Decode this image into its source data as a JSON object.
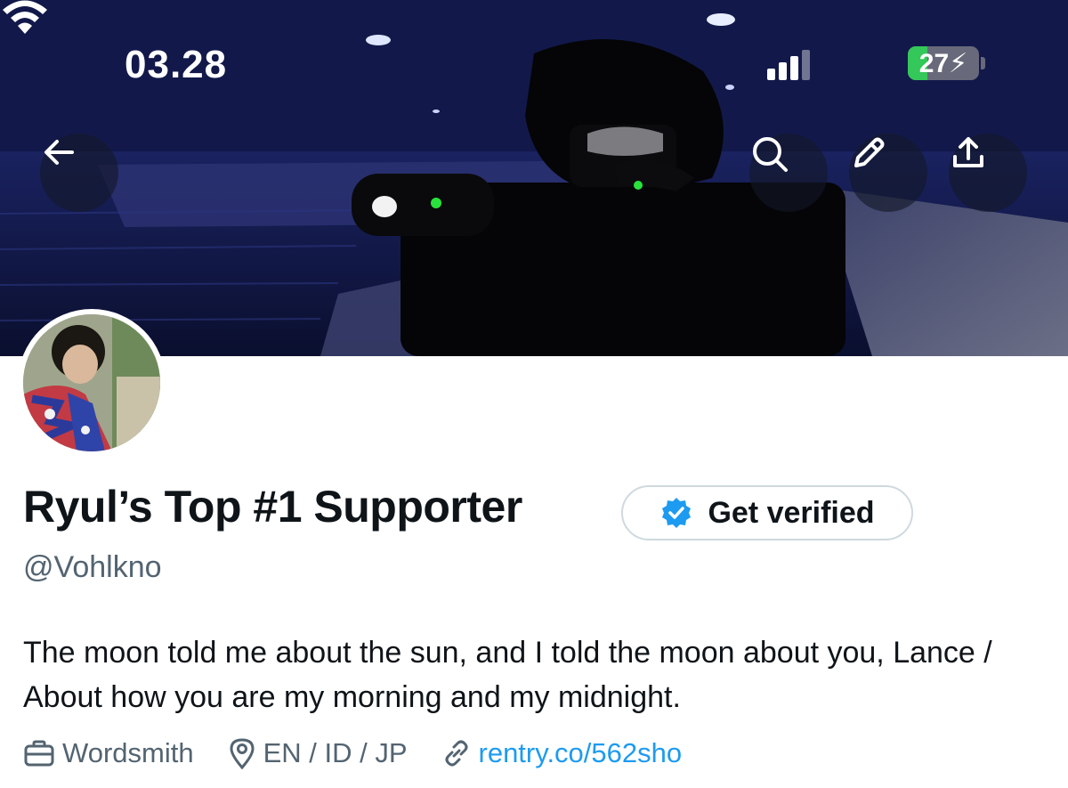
{
  "status_bar": {
    "time": "03.28",
    "battery_level": "27",
    "battery_percent": 27,
    "signal_icon": "cellular-signal-icon",
    "wifi_icon": "wifi-icon",
    "charging_icon": "bolt-icon"
  },
  "header": {
    "back_icon": "arrow-left-icon",
    "search_icon": "search-icon",
    "edit_icon": "pencil-icon",
    "share_icon": "share-icon"
  },
  "profile": {
    "display_name": "Ryul’s Top #1 Supporter",
    "verify_label": "Get verified",
    "handle": "@Vohlkno",
    "bio": "The moon told me about the sun, and I told the moon about you, Lance / About how you are my morning and my midnight.",
    "profession": "Wordsmith",
    "location": "EN / ID / JP",
    "website": "rentry.co/562sho"
  },
  "colors": {
    "link": "#1d9bf0",
    "verified_badge": "#1d9bf0",
    "muted_text": "#536471",
    "primary_text": "#0f1419",
    "battery_fill": "#34c759"
  }
}
